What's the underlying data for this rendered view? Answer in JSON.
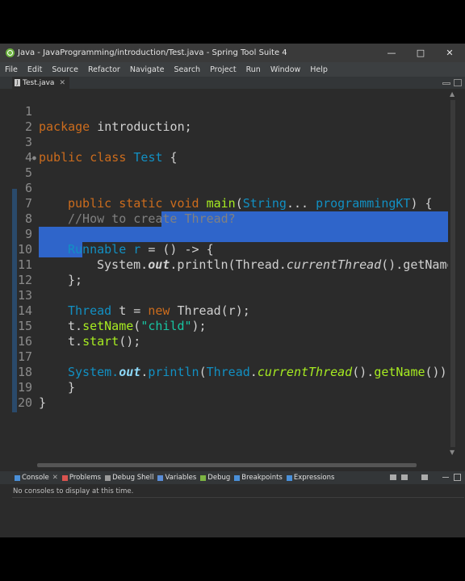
{
  "window": {
    "title": "Java - JavaProgramming/introduction/Test.java - Spring Tool Suite 4"
  },
  "menu": [
    "File",
    "Edit",
    "Source",
    "Refactor",
    "Navigate",
    "Search",
    "Project",
    "Run",
    "Window",
    "Help"
  ],
  "editor_tab": {
    "label": "Test.java"
  },
  "code_lines": [
    {
      "n": "1"
    },
    {
      "n": "2"
    },
    {
      "n": "3"
    },
    {
      "n": "4"
    },
    {
      "n": "5"
    },
    {
      "n": "6"
    },
    {
      "n": "7"
    },
    {
      "n": "8"
    },
    {
      "n": "9"
    },
    {
      "n": "10"
    },
    {
      "n": "11"
    },
    {
      "n": "12"
    },
    {
      "n": "13"
    },
    {
      "n": "14"
    },
    {
      "n": "15"
    },
    {
      "n": "16"
    },
    {
      "n": "17"
    },
    {
      "n": "18"
    },
    {
      "n": "19"
    },
    {
      "n": "20"
    }
  ],
  "code": {
    "l1_kw": "package",
    "l1_rest": " introduction;",
    "l3_kw": "public class",
    "l3_name": " Test",
    "l3_rest": " {",
    "l5_kw": "public static void",
    "l5_method": " main",
    "l5_open": "(",
    "l5_type": "String",
    "l5_dots": "... ",
    "l5_param": "programmingKT",
    "l5_close": ") {",
    "l7_comment": "//How to create Thread?",
    "l9_type": "Runnable",
    "l9_var": " r",
    "l9_eq": " = ",
    "l9_sel": "() -> {",
    "l10_sel_a": "System.",
    "l10_sel_out": "out",
    "l10_sel_b": ".println(Thread.",
    "l10_sel_ct": "currentThread",
    "l10_sel_c": "().getName",
    "l11_sel": "};",
    "l13_type": "Thread",
    "l13_var": " t",
    "l13_eq": " = ",
    "l13_kw": "new",
    "l13_rest": " Thread(r);",
    "l14_a": "t.",
    "l14_method": "setName",
    "l14_open": "(",
    "l14_str": "\"child\"",
    "l14_close": ");",
    "l15_a": "t.",
    "l15_method": "start",
    "l15_b": "();",
    "l17_a": "System.",
    "l17_out": "out",
    "l17_dot": ".",
    "l17_println": "println",
    "l17_open": "(",
    "l17_thread": "Thread",
    "l17_dot2": ".",
    "l17_ct": "currentThread",
    "l17_b": "().",
    "l17_getname": "getName",
    "l17_c": "())",
    "l18": "}",
    "l19": "}"
  },
  "console_tabs": [
    "Console",
    "Problems",
    "Debug Shell",
    "Variables",
    "Debug",
    "Breakpoints",
    "Expressions"
  ],
  "console_message": "No consoles to display at this time.",
  "colors": {
    "keyword": "#cc6c1d",
    "type": "#1290c3",
    "comment": "#808080",
    "string": "#17c6a3",
    "method": "#a7ec21",
    "selection": "#2f65ca",
    "brand": "#6db33f"
  }
}
